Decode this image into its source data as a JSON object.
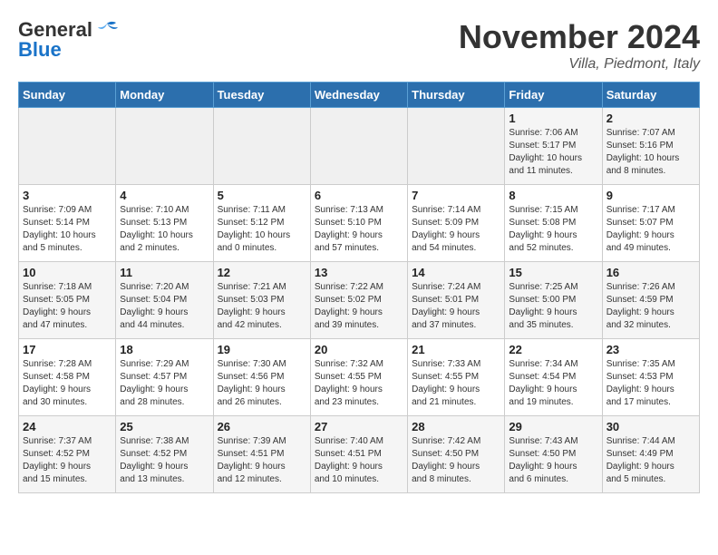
{
  "header": {
    "logo_general": "General",
    "logo_blue": "Blue",
    "month": "November 2024",
    "location": "Villa, Piedmont, Italy"
  },
  "weekdays": [
    "Sunday",
    "Monday",
    "Tuesday",
    "Wednesday",
    "Thursday",
    "Friday",
    "Saturday"
  ],
  "weeks": [
    [
      {
        "day": "",
        "info": ""
      },
      {
        "day": "",
        "info": ""
      },
      {
        "day": "",
        "info": ""
      },
      {
        "day": "",
        "info": ""
      },
      {
        "day": "",
        "info": ""
      },
      {
        "day": "1",
        "info": "Sunrise: 7:06 AM\nSunset: 5:17 PM\nDaylight: 10 hours\nand 11 minutes."
      },
      {
        "day": "2",
        "info": "Sunrise: 7:07 AM\nSunset: 5:16 PM\nDaylight: 10 hours\nand 8 minutes."
      }
    ],
    [
      {
        "day": "3",
        "info": "Sunrise: 7:09 AM\nSunset: 5:14 PM\nDaylight: 10 hours\nand 5 minutes."
      },
      {
        "day": "4",
        "info": "Sunrise: 7:10 AM\nSunset: 5:13 PM\nDaylight: 10 hours\nand 2 minutes."
      },
      {
        "day": "5",
        "info": "Sunrise: 7:11 AM\nSunset: 5:12 PM\nDaylight: 10 hours\nand 0 minutes."
      },
      {
        "day": "6",
        "info": "Sunrise: 7:13 AM\nSunset: 5:10 PM\nDaylight: 9 hours\nand 57 minutes."
      },
      {
        "day": "7",
        "info": "Sunrise: 7:14 AM\nSunset: 5:09 PM\nDaylight: 9 hours\nand 54 minutes."
      },
      {
        "day": "8",
        "info": "Sunrise: 7:15 AM\nSunset: 5:08 PM\nDaylight: 9 hours\nand 52 minutes."
      },
      {
        "day": "9",
        "info": "Sunrise: 7:17 AM\nSunset: 5:07 PM\nDaylight: 9 hours\nand 49 minutes."
      }
    ],
    [
      {
        "day": "10",
        "info": "Sunrise: 7:18 AM\nSunset: 5:05 PM\nDaylight: 9 hours\nand 47 minutes."
      },
      {
        "day": "11",
        "info": "Sunrise: 7:20 AM\nSunset: 5:04 PM\nDaylight: 9 hours\nand 44 minutes."
      },
      {
        "day": "12",
        "info": "Sunrise: 7:21 AM\nSunset: 5:03 PM\nDaylight: 9 hours\nand 42 minutes."
      },
      {
        "day": "13",
        "info": "Sunrise: 7:22 AM\nSunset: 5:02 PM\nDaylight: 9 hours\nand 39 minutes."
      },
      {
        "day": "14",
        "info": "Sunrise: 7:24 AM\nSunset: 5:01 PM\nDaylight: 9 hours\nand 37 minutes."
      },
      {
        "day": "15",
        "info": "Sunrise: 7:25 AM\nSunset: 5:00 PM\nDaylight: 9 hours\nand 35 minutes."
      },
      {
        "day": "16",
        "info": "Sunrise: 7:26 AM\nSunset: 4:59 PM\nDaylight: 9 hours\nand 32 minutes."
      }
    ],
    [
      {
        "day": "17",
        "info": "Sunrise: 7:28 AM\nSunset: 4:58 PM\nDaylight: 9 hours\nand 30 minutes."
      },
      {
        "day": "18",
        "info": "Sunrise: 7:29 AM\nSunset: 4:57 PM\nDaylight: 9 hours\nand 28 minutes."
      },
      {
        "day": "19",
        "info": "Sunrise: 7:30 AM\nSunset: 4:56 PM\nDaylight: 9 hours\nand 26 minutes."
      },
      {
        "day": "20",
        "info": "Sunrise: 7:32 AM\nSunset: 4:55 PM\nDaylight: 9 hours\nand 23 minutes."
      },
      {
        "day": "21",
        "info": "Sunrise: 7:33 AM\nSunset: 4:55 PM\nDaylight: 9 hours\nand 21 minutes."
      },
      {
        "day": "22",
        "info": "Sunrise: 7:34 AM\nSunset: 4:54 PM\nDaylight: 9 hours\nand 19 minutes."
      },
      {
        "day": "23",
        "info": "Sunrise: 7:35 AM\nSunset: 4:53 PM\nDaylight: 9 hours\nand 17 minutes."
      }
    ],
    [
      {
        "day": "24",
        "info": "Sunrise: 7:37 AM\nSunset: 4:52 PM\nDaylight: 9 hours\nand 15 minutes."
      },
      {
        "day": "25",
        "info": "Sunrise: 7:38 AM\nSunset: 4:52 PM\nDaylight: 9 hours\nand 13 minutes."
      },
      {
        "day": "26",
        "info": "Sunrise: 7:39 AM\nSunset: 4:51 PM\nDaylight: 9 hours\nand 12 minutes."
      },
      {
        "day": "27",
        "info": "Sunrise: 7:40 AM\nSunset: 4:51 PM\nDaylight: 9 hours\nand 10 minutes."
      },
      {
        "day": "28",
        "info": "Sunrise: 7:42 AM\nSunset: 4:50 PM\nDaylight: 9 hours\nand 8 minutes."
      },
      {
        "day": "29",
        "info": "Sunrise: 7:43 AM\nSunset: 4:50 PM\nDaylight: 9 hours\nand 6 minutes."
      },
      {
        "day": "30",
        "info": "Sunrise: 7:44 AM\nSunset: 4:49 PM\nDaylight: 9 hours\nand 5 minutes."
      }
    ]
  ]
}
